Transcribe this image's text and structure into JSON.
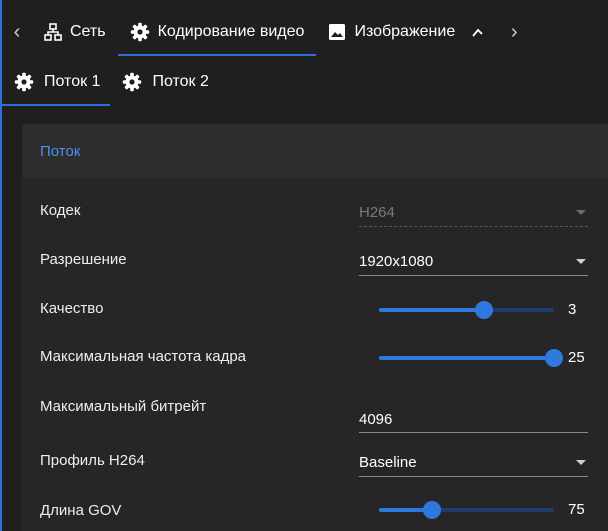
{
  "top_tabs": {
    "items": [
      {
        "label": "Сеть",
        "icon": "network-icon",
        "active": false
      },
      {
        "label": "Кодирование видео",
        "icon": "gear-icon",
        "active": true
      },
      {
        "label": "Изображение",
        "icon": "image-icon",
        "active": false
      }
    ]
  },
  "sub_tabs": {
    "items": [
      {
        "label": "Поток 1",
        "icon": "gear-icon",
        "active": true
      },
      {
        "label": "Поток 2",
        "icon": "gear-icon",
        "active": false
      }
    ]
  },
  "panel": {
    "title": "Поток",
    "fields": {
      "codec": {
        "label": "Кодек",
        "value": "H264",
        "disabled": true
      },
      "resolution": {
        "label": "Разрешение",
        "value": "1920x1080"
      },
      "quality": {
        "label": "Качество",
        "value": "3",
        "fraction": 0.6
      },
      "max_fps": {
        "label": "Максимальная частота кадра",
        "value": "25",
        "fraction": 1.0
      },
      "max_bitrate": {
        "label": "Максимальный битрейт",
        "value": "4096"
      },
      "profile": {
        "label": "Профиль H264",
        "value": "Baseline"
      },
      "gov_length": {
        "label": "Длина GOV",
        "value": "75",
        "fraction": 0.3
      }
    }
  },
  "colors": {
    "accent": "#2f78e0",
    "header_text": "#4f8ff0",
    "background": "#1f1f1f",
    "panel": "#262626"
  }
}
